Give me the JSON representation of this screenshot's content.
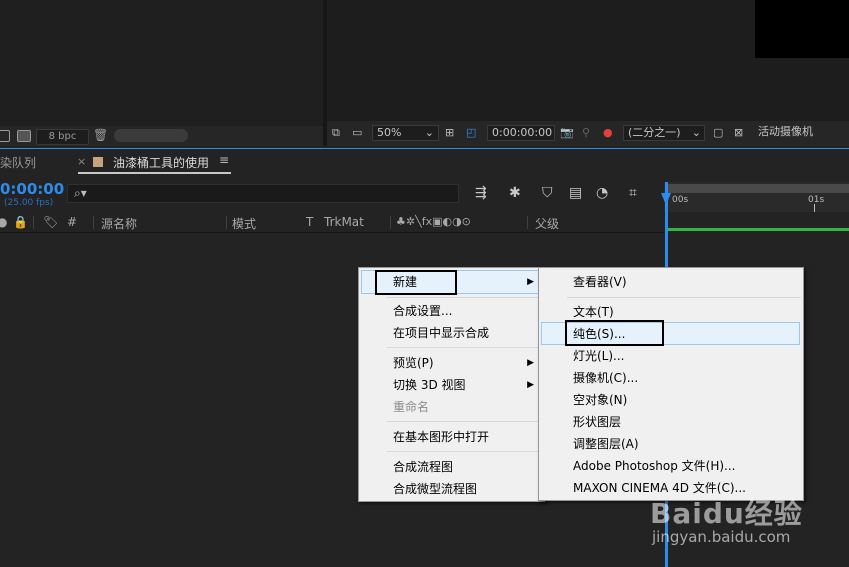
{
  "project_panel": {
    "bpc_label": "8 bpc"
  },
  "viewer_toolbar": {
    "zoom": "50%",
    "timecode": "0:00:00:00",
    "resolution": "(二分之一)",
    "camera": "活动摄像机"
  },
  "timeline": {
    "tab_render_queue": "染队列",
    "tab_comp_name": "油漆桶工具的使用",
    "timecode": "0:00:00",
    "fps": "(25.00 fps)",
    "ruler": {
      "start": "00s",
      "mark_1": "01s"
    },
    "columns": {
      "hash": "#",
      "source_name": "源名称",
      "mode": "模式",
      "t": "T",
      "trkmat": "TrkMat",
      "parent": "父级"
    },
    "colors": {
      "accent": "#2d8ceb",
      "work_area": "#2fb640",
      "label_swatch": "#c6a37a"
    }
  },
  "context_menu": {
    "items": [
      {
        "label": "新建",
        "has_submenu": true,
        "highlighted": true
      },
      {
        "label": "合成设置..."
      },
      {
        "label": "在项目中显示合成"
      },
      {
        "label": "预览(P)",
        "has_submenu": true
      },
      {
        "label": "切换 3D 视图",
        "has_submenu": true
      },
      {
        "label": "重命名",
        "disabled": true
      },
      {
        "label": "在基本图形中打开"
      },
      {
        "label": "合成流程图"
      },
      {
        "label": "合成微型流程图"
      }
    ]
  },
  "submenu_new": {
    "items": [
      {
        "label": "查看器(V)"
      },
      {
        "label": "文本(T)"
      },
      {
        "label": "纯色(S)...",
        "highlighted": true
      },
      {
        "label": "灯光(L)..."
      },
      {
        "label": "摄像机(C)..."
      },
      {
        "label": "空对象(N)"
      },
      {
        "label": "形状图层"
      },
      {
        "label": "调整图层(A)"
      },
      {
        "label": "Adobe Photoshop 文件(H)..."
      },
      {
        "label": "MAXON CINEMA 4D 文件(C)..."
      }
    ]
  },
  "watermark": {
    "brand": "Baidu经验",
    "url": "jingyan.baidu.com"
  }
}
